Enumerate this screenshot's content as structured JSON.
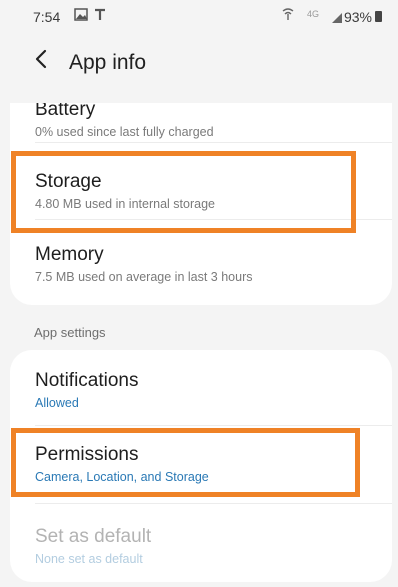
{
  "status_bar": {
    "time": "7:54",
    "icons": [
      "gallery-icon",
      "t-icon"
    ],
    "network": "4G",
    "battery": "93%"
  },
  "header": {
    "title": "App info",
    "back_icon": "back-arrow-icon"
  },
  "card1": {
    "items": [
      {
        "title": "Battery",
        "subtitle": "0% used since last fully charged"
      },
      {
        "title": "Storage",
        "subtitle": "4.80 MB used in internal storage"
      },
      {
        "title": "Memory",
        "subtitle": "7.5 MB used on average in last 3 hours"
      }
    ]
  },
  "section": {
    "label": "App settings"
  },
  "card2": {
    "items": [
      {
        "title": "Notifications",
        "subtitle": "Allowed"
      },
      {
        "title": "Permissions",
        "subtitle": "Camera, Location, and Storage"
      },
      {
        "title": "Set as default",
        "subtitle": "None set as default"
      }
    ]
  },
  "colors": {
    "highlight": "#ef8226",
    "accent": "#2a79b5",
    "background": "#f4f4f4",
    "card": "#ffffff"
  }
}
